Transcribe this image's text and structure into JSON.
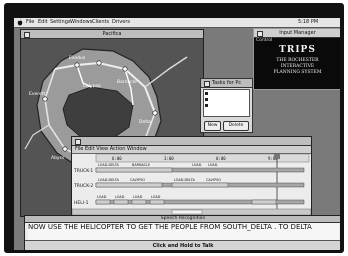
{
  "menubar": {
    "items": [
      "File",
      "Edit",
      "Settings",
      "Windows",
      "Clients",
      "Drivers"
    ],
    "clock": "5:18 PM"
  },
  "map_window": {
    "title": "Pacifica",
    "labels": [
      "Exodus",
      "Calypso",
      "Barnacle",
      "Delta",
      "South Delta",
      "Abyss",
      "Everett"
    ]
  },
  "trips_panel": {
    "title_bar": "Input Manager",
    "control_label": "Control",
    "title": "TRIPS",
    "subtitle_line1": "THE ROCHESTER",
    "subtitle_line2": "INTERACTIVE",
    "subtitle_line3": "PLANNING SYSTEM"
  },
  "tasks_window": {
    "title": "Tasks for Pc",
    "new_label": "New",
    "delete_label": "Delete"
  },
  "schedule_window": {
    "title": "",
    "menu": [
      "File",
      "Edit",
      "View",
      "Action",
      "Window"
    ],
    "timeline_ticks": [
      "6:00",
      "3:00",
      "0:00",
      "9:00"
    ],
    "rows": [
      "TRUCK-1",
      "TRUCK-2",
      "HELI-1"
    ],
    "truck1_segments": [
      "LOAD-DELTA",
      "BARNACLE",
      "LOAD",
      "LOAD"
    ],
    "truck2_segments": [
      "LOAD-DELTA",
      "CALYPSO",
      "LOAD-DELTA",
      "CALYPSO"
    ],
    "heli_segments": [
      "LOAD",
      "LOAD",
      "LOAD",
      "LOAD"
    ]
  },
  "speech_window": {
    "title": "Speech Recognition",
    "text": "NOW USE THE HELICOPTER TO GET THE PEOPLE FROM SOUTH_DELTA . TO DELTA",
    "button_label": "Click and Hold to Talk"
  }
}
